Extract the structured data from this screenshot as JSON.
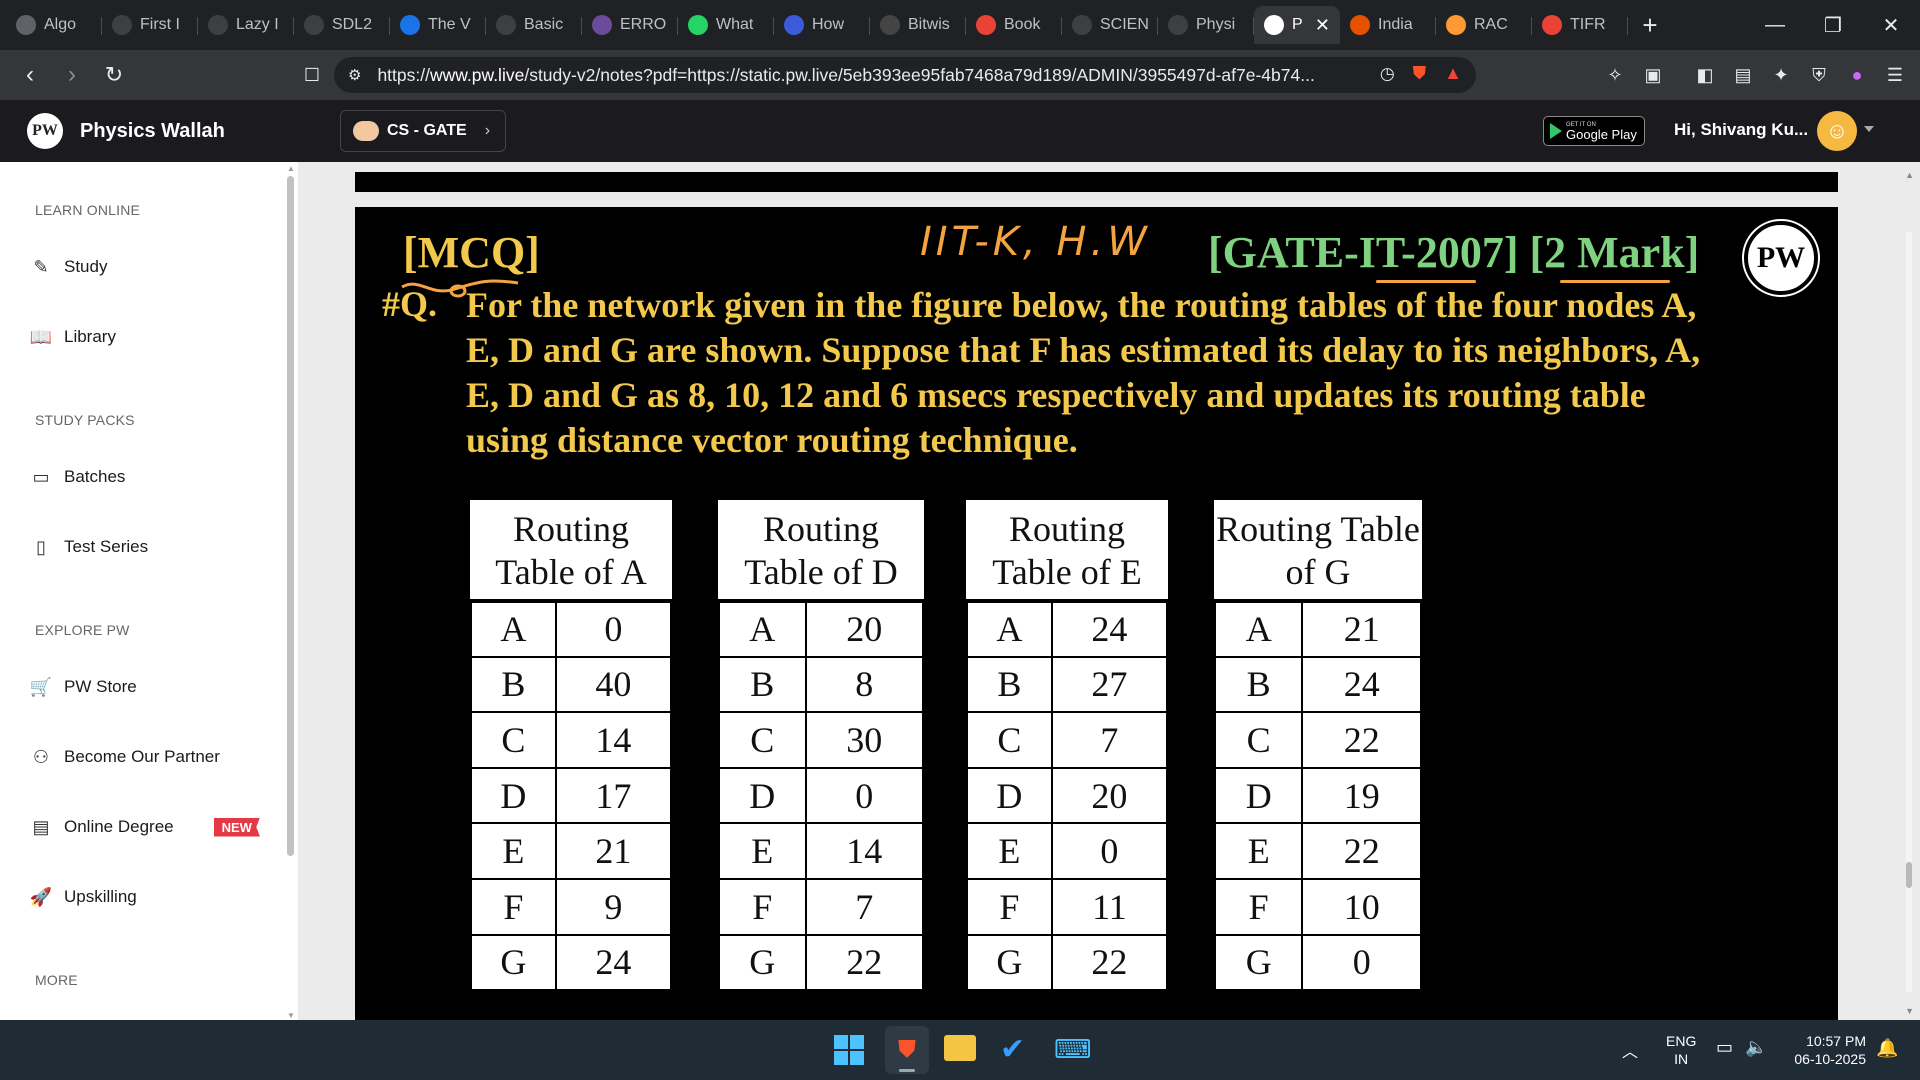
{
  "browser": {
    "tabs": [
      {
        "label": "Algo"
      },
      {
        "label": "First I"
      },
      {
        "label": "Lazy I"
      },
      {
        "label": "SDL2"
      },
      {
        "label": "The V"
      },
      {
        "label": "Basic"
      },
      {
        "label": "ERRO"
      },
      {
        "label": "What"
      },
      {
        "label": "How"
      },
      {
        "label": "Bitwis"
      },
      {
        "label": "Book"
      },
      {
        "label": "SCIEN"
      },
      {
        "label": "Physi"
      },
      {
        "label": "P",
        "active": true
      },
      {
        "label": "India"
      },
      {
        "label": "RAC"
      },
      {
        "label": "TIFR"
      }
    ],
    "url_prefix": "https://",
    "url_host": "www.pw.live",
    "url_rest": "/study-v2/notes?pdf=https://static.pw.live/5eb393ee95fab7468a79d189/ADMIN/3955497d-af7e-4b74..."
  },
  "header": {
    "app_name": "Physics Wallah",
    "logo_text": "PW",
    "batch": "CS - GATE",
    "play_small": "GET IT ON",
    "play_big": "Google Play",
    "greeting": "Hi, Shivang Ku..."
  },
  "sidebar": {
    "sections": [
      {
        "title": "LEARN ONLINE"
      },
      {
        "title": "STUDY PACKS"
      },
      {
        "title": "EXPLORE PW"
      },
      {
        "title": "MORE"
      }
    ],
    "items": [
      {
        "label": "Study",
        "icon": "edit-icon"
      },
      {
        "label": "Library",
        "icon": "book-icon"
      },
      {
        "label": "Batches",
        "icon": "monitor-icon"
      },
      {
        "label": "Test Series",
        "icon": "clipboard-icon"
      },
      {
        "label": "PW Store",
        "icon": "cart-icon"
      },
      {
        "label": "Become Our Partner",
        "icon": "partner-icon"
      },
      {
        "label": "Online Degree",
        "icon": "degree-icon",
        "badge": "NEW"
      },
      {
        "label": "Upskilling",
        "icon": "rocket-icon"
      }
    ]
  },
  "document": {
    "tag": "[MCQ]",
    "handwritten_note": "IIT-K, H.W",
    "exam": "[GATE-IT-2007] [2 Mark]",
    "qnum": "#Q.",
    "question": "For the network given in the figure below, the routing tables of the four nodes A, E, D and G are shown. Suppose that F has estimated its delay to its neighbors, A, E, D and G as 8, 10, 12 and 6 msecs respectively and updates its routing table using distance vector routing technique.",
    "tables": [
      {
        "title": "Routing Table of A",
        "rows": [
          [
            "A",
            "0"
          ],
          [
            "B",
            "40"
          ],
          [
            "C",
            "14"
          ],
          [
            "D",
            "17"
          ],
          [
            "E",
            "21"
          ],
          [
            "F",
            "9"
          ],
          [
            "G",
            "24"
          ]
        ]
      },
      {
        "title": "Routing Table of D",
        "rows": [
          [
            "A",
            "20"
          ],
          [
            "B",
            "8"
          ],
          [
            "C",
            "30"
          ],
          [
            "D",
            "0"
          ],
          [
            "E",
            "14"
          ],
          [
            "F",
            "7"
          ],
          [
            "G",
            "22"
          ]
        ]
      },
      {
        "title": "Routing Table of E",
        "rows": [
          [
            "A",
            "24"
          ],
          [
            "B",
            "27"
          ],
          [
            "C",
            "7"
          ],
          [
            "D",
            "20"
          ],
          [
            "E",
            "0"
          ],
          [
            "F",
            "11"
          ],
          [
            "G",
            "22"
          ]
        ]
      },
      {
        "title": "Routing Table of G",
        "rows": [
          [
            "A",
            "21"
          ],
          [
            "B",
            "24"
          ],
          [
            "C",
            "22"
          ],
          [
            "D",
            "19"
          ],
          [
            "E",
            "22"
          ],
          [
            "F",
            "10"
          ],
          [
            "G",
            "0"
          ]
        ]
      }
    ]
  },
  "taskbar": {
    "lang": "ENG",
    "region": "IN",
    "time": "10:57 PM",
    "date": "06-10-2025"
  },
  "colors": {
    "question_text": "#f2c94c",
    "exam_tag": "#7fd27f",
    "handwriting": "#f4a340",
    "badge_new": "#e63946"
  }
}
